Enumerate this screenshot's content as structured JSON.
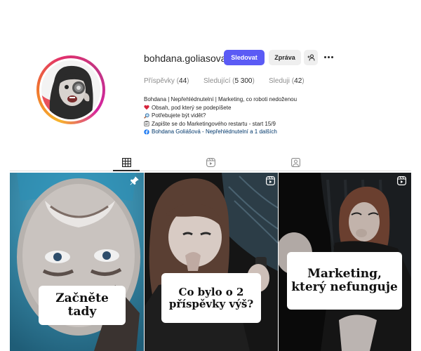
{
  "profile": {
    "username": "bohdana.goliasova",
    "follow_label": "Sledovat",
    "message_label": "Zpráva",
    "add_icon": "add-person-icon",
    "more_icon": "more-options-icon"
  },
  "stats": {
    "posts_label": "Příspěvky",
    "posts_count": "44",
    "followers_label": "Sledující",
    "followers_count": "5 300",
    "following_label": "Sleduji",
    "following_count": "42"
  },
  "bio": {
    "headline": "Bohdana | Nepřehlédnutelní | Marketing, co roboti nedoženou",
    "line1": "Obsah, pod který se podepíšete",
    "line1_icon": "heart-icon",
    "line2": "Potřebujete být vidět?",
    "line2_icon": "magnifier-icon",
    "line3": "Zapište se do Marketingového restartu - start 15/9",
    "line3_icon": "clipboard-icon",
    "link": "Bohdana Goliášová - Nepřehlédnutelní a 1 dalších",
    "link_icon": "facebook-icon"
  },
  "tabs": [
    {
      "icon": "grid-icon",
      "active": true
    },
    {
      "icon": "reels-icon",
      "active": false
    },
    {
      "icon": "tagged-icon",
      "active": false
    }
  ],
  "posts": [
    {
      "caption": "Začněte tady",
      "badge": "pin-icon"
    },
    {
      "caption": "Co bylo o 2 příspěvky výš?",
      "badge": "none"
    },
    {
      "caption": "Marketing, který nefunguje",
      "badge": "reel-icon"
    }
  ],
  "colors": {
    "follow_button": "#5b5bf5",
    "secondary_button": "#efefef",
    "link": "#00376b",
    "muted_text": "#8e8e8e"
  }
}
